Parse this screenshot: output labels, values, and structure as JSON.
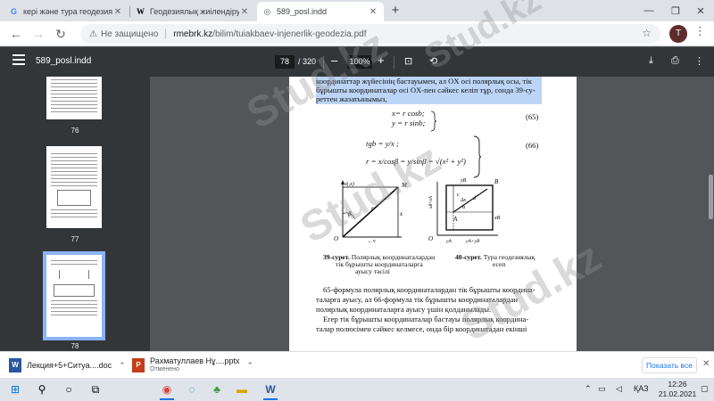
{
  "tabs": [
    {
      "label": "кері және тура геодезиялық",
      "favicon": "G"
    },
    {
      "label": "Геодезиялық жиілендіру жән",
      "favicon": "W"
    },
    {
      "label": "589_posl.indd",
      "favicon": "◎"
    }
  ],
  "address": {
    "security": "Не защищено",
    "domain": "rmebrk.kz",
    "path": "/bilim/tuiakbaev-injenerlik-geodezia.pdf",
    "avatar": "T"
  },
  "pdf": {
    "filename": "589_posl.indd",
    "page": "78",
    "total": "/ 320",
    "zoom": "100%",
    "thumbs": [
      "76",
      "77",
      "78"
    ]
  },
  "doc": {
    "line1": "координаттар жүйесінің бастауымен, ал OX осі полярлық осы, тік",
    "line2": "бұрышты координаталар осі OX-пен сәйкес келіп тұр, сонда 39-су-",
    "line3": "реттен жазатынымыз,",
    "f65a": "x= r cosb;",
    "f65b": "y = r sinb;",
    "n65": "(65)",
    "f66a": "tgb = y/x ;",
    "f66b": "r = x/cosβ = y/sinβ = √(x² + y²)",
    "n66": "(66)",
    "fig39_bold": "39-сурет.",
    "fig39_a": "Полярлық координаталардан",
    "fig39_b": "тік бұрышты координаталарға",
    "fig39_c": "ауысу тәсілі",
    "fig40_bold": "40-сурет.",
    "fig40_a": "Тура геодезиялық",
    "fig40_b": "есеп",
    "p1": "65-формула полярлық координаталардан тік бұрышты координа-",
    "p2": "таларға ауысу, ал 66-формула тік бұрышты координаталардан",
    "p3": "полярлық координаталарға ауысу үшін қолданылады.",
    "p4": "Егер тік бұрышты координаталар бастауы полярлық координа-",
    "p5": "талар полюсімен сәйкес келмесе, онда бір координатадан екінші"
  },
  "downloads": [
    {
      "name": "Лекция+5+Ситуа....doc",
      "sub": ""
    },
    {
      "name": "Рахматуллаев Нұ....pptx",
      "sub": "Отменено"
    }
  ],
  "download_showall": "Показать все",
  "taskbar": {
    "lang": "ҚАЗ",
    "time": "12:26",
    "date": "21.02.2021"
  },
  "watermark": "Stud.kz",
  "colors": {
    "pdf_toolbar": "#323639",
    "viewer_bg": "#525659",
    "selection": "#bcd4f5",
    "accent": "#1a73e8"
  }
}
